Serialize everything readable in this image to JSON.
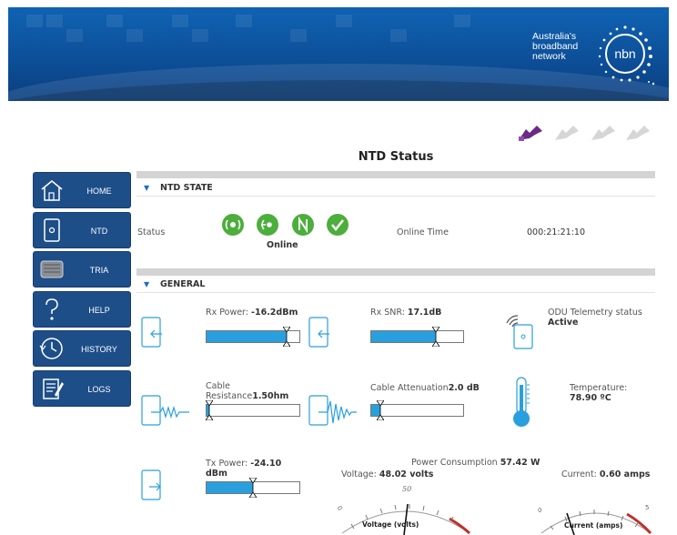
{
  "brand": {
    "line1": "Australia's",
    "line2": "broadband",
    "line3": "network",
    "logo_text": "nbn"
  },
  "page_title": "NTD Status",
  "nav": [
    {
      "label": "HOME",
      "icon": "home-icon"
    },
    {
      "label": "NTD",
      "icon": "ntd-device-icon"
    },
    {
      "label": "TRIA",
      "icon": "tria-device-icon"
    },
    {
      "label": "HELP",
      "icon": "help-icon"
    },
    {
      "label": "HISTORY",
      "icon": "history-icon"
    },
    {
      "label": "LOGS",
      "icon": "logs-icon"
    }
  ],
  "ntd_state": {
    "title": "NTD STATE",
    "status_label": "Status",
    "status_value": "Online",
    "online_time_label": "Online Time",
    "online_time_value": "000:21:21:10"
  },
  "general": {
    "title": "GENERAL",
    "rx_power_label": "Rx Power: ",
    "rx_power_value": "-16.2dBm",
    "rx_power_level": 0.86,
    "rx_snr_label": "Rx SNR: ",
    "rx_snr_value": "17.1dB",
    "rx_snr_level": 0.7,
    "odu_label": "ODU Telemetry status",
    "odu_value": "Active",
    "cable_res_label1": "Cable",
    "cable_res_label2": "Resistance",
    "cable_res_value": "1.50hm",
    "cable_res_level": 0.03,
    "cable_att_label": "Cable Attenuation",
    "cable_att_value": "2.0 dB",
    "cable_att_level": 0.1,
    "temp_label": "Temperature:",
    "temp_value": "78.90 ºC",
    "tx_power_label": "Tx Power: ",
    "tx_power_value": "-24.10",
    "tx_power_unit": "dBm",
    "tx_power_level": 0.5,
    "power_cons_label": "Power Consumption ",
    "power_cons_value": "57.42 W",
    "voltage_label": "Voltage: ",
    "voltage_value": "48.02 volts",
    "voltage_gauge_title": "Voltage (volts)",
    "voltage_tick_0": "0",
    "voltage_tick_mid": "50",
    "current_label": "Current: ",
    "current_value": "0.60 amps",
    "current_gauge_title": "Current (amps)",
    "current_tick_0": "0",
    "current_tick_max": "5"
  },
  "colors": {
    "banner": "#0d4f99",
    "nav": "#1d4e88",
    "accent": "#2a9fdd",
    "status_green": "#4cae3c",
    "step_purple": "#6b2a86"
  }
}
